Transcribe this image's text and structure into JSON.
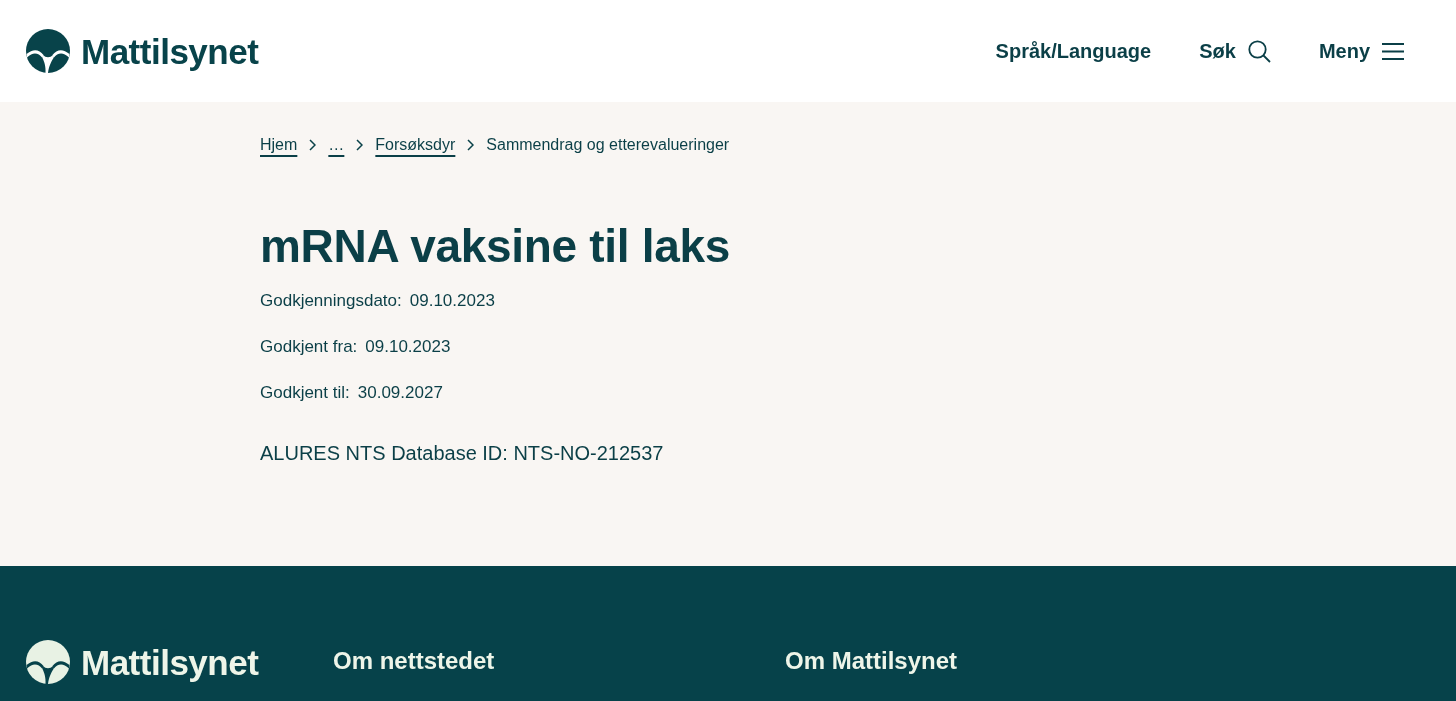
{
  "header": {
    "logo_text": "Mattilsynet",
    "nav": [
      {
        "label": "Språk/Language",
        "kind": "text"
      },
      {
        "label": "Søk",
        "kind": "search"
      },
      {
        "label": "Meny",
        "kind": "menu"
      }
    ]
  },
  "breadcrumb": [
    {
      "label": "Hjem",
      "kind": "link"
    },
    {
      "label": "…",
      "kind": "link"
    },
    {
      "label": "Forsøksdyr",
      "kind": "link"
    },
    {
      "label": "Sammendrag og etterevalueringer",
      "kind": "current"
    }
  ],
  "title": "mRNA vaksine til laks",
  "fields": [
    {
      "label": "Godkjenningsdato:",
      "value": "09.10.2023"
    },
    {
      "label": "Godkjent fra:",
      "value": "09.10.2023"
    },
    {
      "label": "Godkjent til:",
      "value": "30.09.2027"
    }
  ],
  "database_id": "ALURES NTS Database ID: NTS-NO-212537",
  "footer": {
    "logo_text": "Mattilsynet",
    "headings": [
      "Om nettstedet",
      "Om Mattilsynet"
    ]
  }
}
